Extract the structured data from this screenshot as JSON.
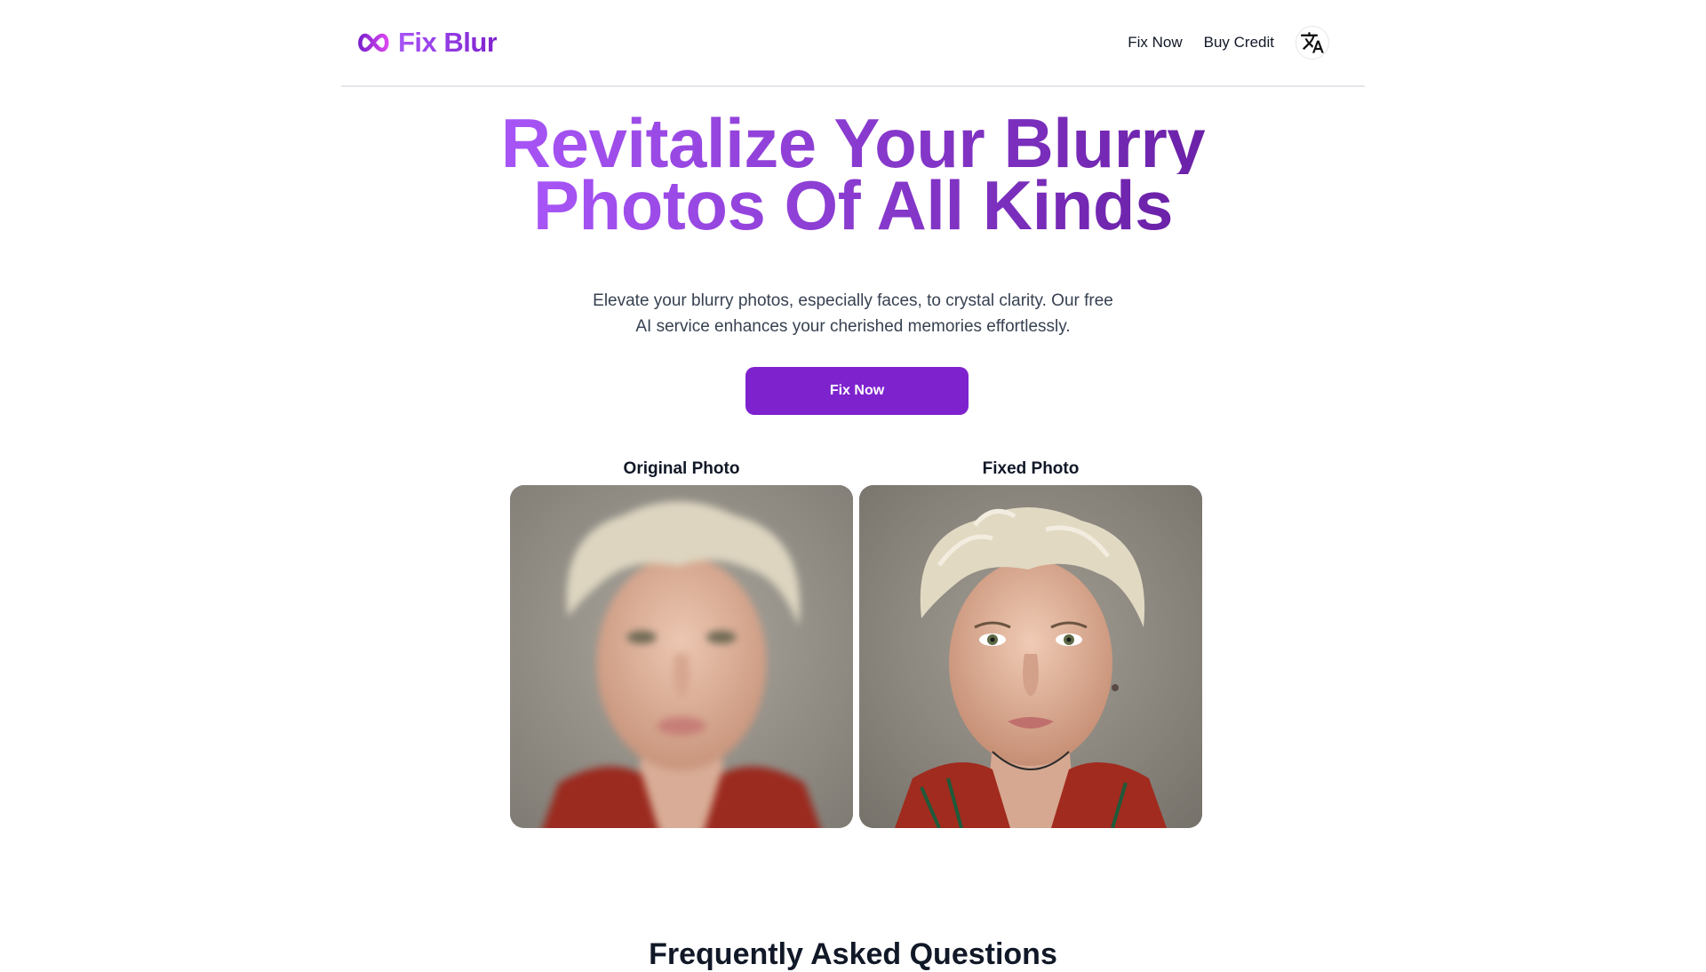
{
  "brand": {
    "name": "Fix Blur",
    "icon": "infinity-logo-icon",
    "gradient_start": "#a855f7",
    "gradient_end": "#7e22ce"
  },
  "nav": {
    "items": [
      {
        "label": "Fix Now"
      },
      {
        "label": "Buy Credit"
      }
    ],
    "language_icon": "translate-icon"
  },
  "hero": {
    "title_line1": "Revitalize Your Blurry",
    "title_line2": "Photos Of All Kinds",
    "description": "Elevate your blurry photos, especially faces, to crystal clarity. Our free AI service enhances your cherished memories effortlessly.",
    "cta_label": "Fix Now",
    "cta_color": "#7e22ce"
  },
  "comparison": {
    "original_label": "Original Photo",
    "fixed_label": "Fixed Photo"
  },
  "faq": {
    "title": "Frequently Asked Questions"
  }
}
